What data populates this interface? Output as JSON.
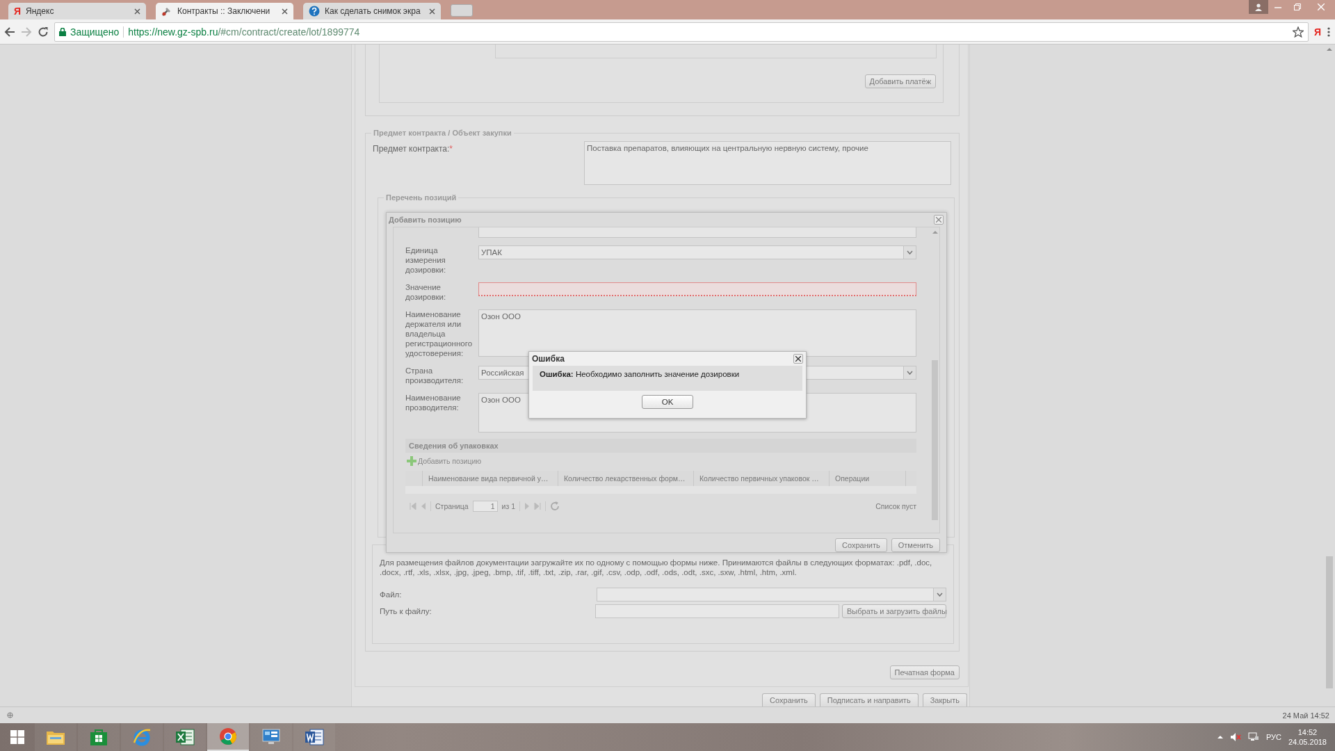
{
  "browser": {
    "tabs": [
      {
        "favicon": "Я",
        "title": "Яндекс",
        "kind": "yandex",
        "selected": false
      },
      {
        "title": "Контракты :: Заключени",
        "kind": "tool",
        "selected": true
      },
      {
        "title": "Как сделать снимок экра",
        "kind": "help",
        "selected": false
      }
    ],
    "security": "Защищено",
    "url_host": "https://new.gz-spb.ru",
    "url_path": "/#cm/contract/create/lot/1899774",
    "extension": "Я"
  },
  "form": {
    "add_payment_button": "Добавить платёж",
    "subject_section": {
      "legend": "Предмет контракта / Объект закупки",
      "label": "Предмет контракта:",
      "required_mark": "*",
      "value": "Поставка препаратов, влияющих на центральную нервную систему, прочие"
    },
    "positions_section": {
      "legend": "Перечень позиций"
    },
    "docs": {
      "description": "Для размещения файлов документации загружайте их по одному с помощью формы ниже. Принимаются файлы в следующих форматах: .pdf, .doc, .docx, .rtf, .xls, .xlsx, .jpg, .jpeg, .bmp, .tif, .tiff, .txt, .zip, .rar, .gif, .csv, .odp, .odf, .ods, .odt, .sxc, .sxw, .html, .htm, .xml.",
      "fields": [
        {
          "label": "Файл:",
          "kind": "select"
        },
        {
          "label": "Путь к файлу:",
          "kind": "input",
          "button": "Выбрать и загрузить файлы"
        }
      ]
    },
    "print_button": "Печатная форма",
    "buttons": [
      "Сохранить",
      "Подписать и направить",
      "Закрыть"
    ]
  },
  "add_position_dialog": {
    "title": "Добавить позицию",
    "fields": [
      {
        "label": "Единица измерения дозировки:",
        "kind": "select",
        "value": "УПАК",
        "invalid": false
      },
      {
        "label": "Значение дозировки:",
        "kind": "input",
        "invalid": true
      },
      {
        "label": "Наименование держателя или владельца регистрационного удостоверения:",
        "kind": "textarea",
        "value": "Озон ООО",
        "invalid": false
      },
      {
        "label": "Страна производителя:",
        "kind": "select",
        "value": "Российская",
        "invalid": false
      },
      {
        "label": "Наименование прозводителя:",
        "kind": "textarea",
        "value": "Озон ООО",
        "invalid": false
      }
    ],
    "packaging": {
      "title": "Сведения об упаковках",
      "add_button": "Добавить позицию",
      "columns": [
        "Наименование вида первичной у…",
        "Количество лекарственных форм…",
        "Количество первичных упаковок …",
        "Операции"
      ],
      "pager": {
        "page_label": "Страница",
        "page": "1",
        "of": "из 1",
        "status": "Список пуст"
      }
    },
    "buttons": [
      "Сохранить",
      "Отменить"
    ]
  },
  "error_dialog": {
    "title": "Ошибка",
    "message": "**Ошибка:** Необходимо заполнить значение дозировки",
    "button": "OK"
  },
  "status_bar": {
    "datetime": "24 Май 14:52"
  },
  "taskbar": {
    "apps": [
      {
        "kind": "explorer",
        "selected": false
      },
      {
        "kind": "store",
        "selected": false
      },
      {
        "kind": "ie",
        "selected": false
      },
      {
        "kind": "excel",
        "selected": false
      },
      {
        "kind": "chrome",
        "selected": true
      },
      {
        "kind": "control",
        "selected": false
      },
      {
        "kind": "word",
        "selected": false
      }
    ],
    "language": "РУС",
    "time": "14:52",
    "date": "24.05.2018"
  }
}
